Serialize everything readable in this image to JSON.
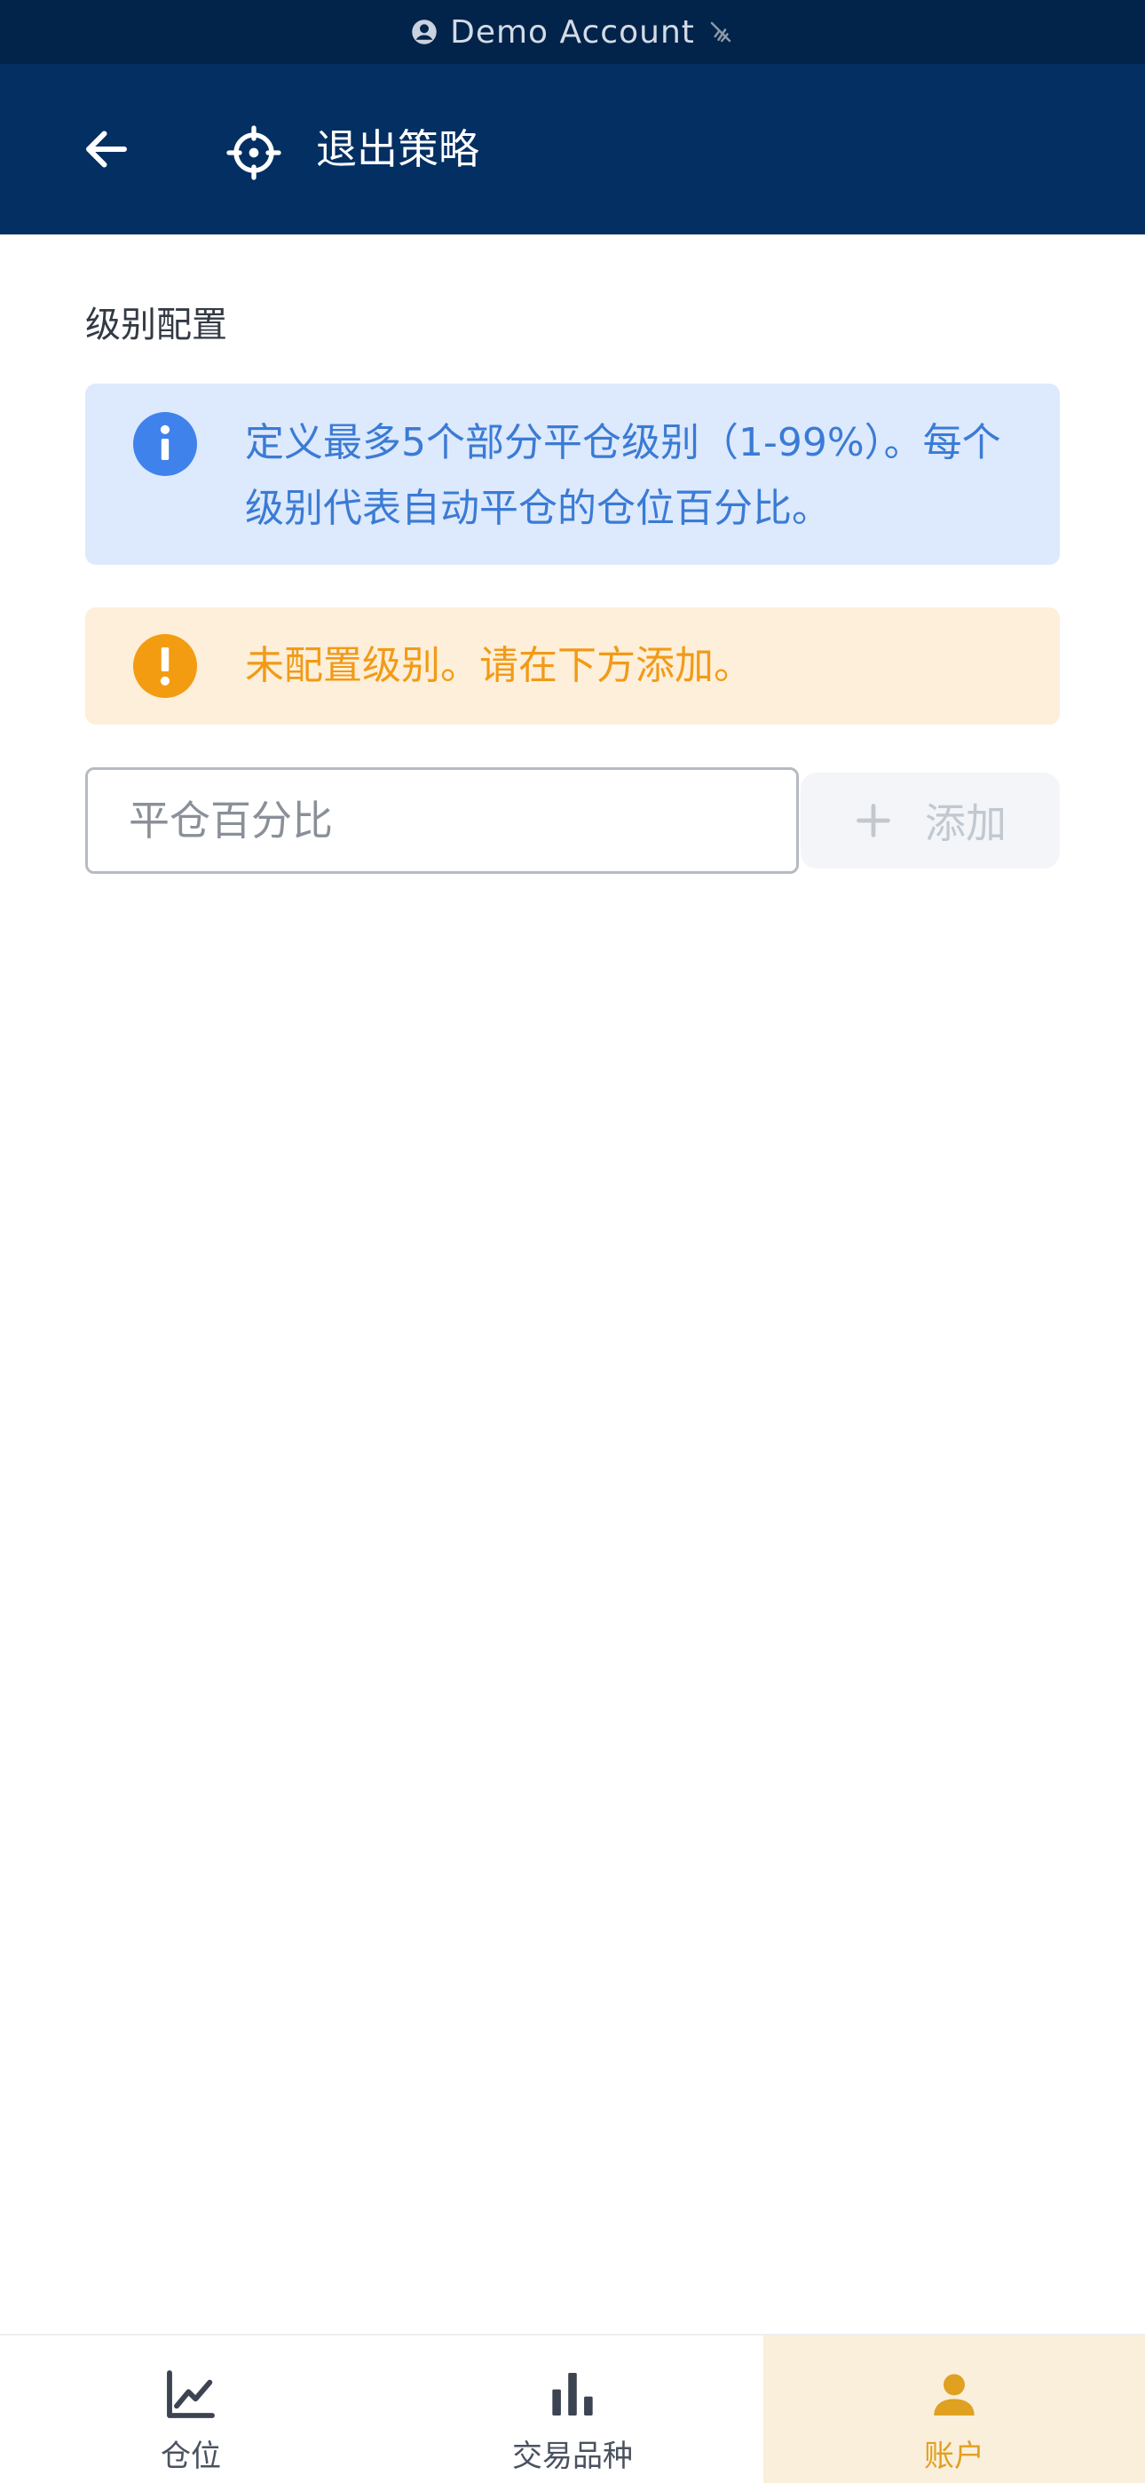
{
  "status_bar": {
    "account_label": "Demo Account",
    "account_icon": "account-circle-icon",
    "signal_icon": "no-connection-icon"
  },
  "header": {
    "back_icon": "arrow-left-icon",
    "title_icon": "crosshair-icon",
    "title": "退出策略"
  },
  "levels": {
    "section_title": "级别配置",
    "info_message": "定义最多5个部分平仓级别（1-99%）。每个级别代表自动平仓的仓位百分比。",
    "warning_message": "未配置级别。请在下方添加。",
    "input_placeholder": "平仓百分比",
    "input_value": "",
    "add_label": "添加"
  },
  "bottom_nav": {
    "items": [
      {
        "label": "仓位",
        "icon": "line-chart-icon",
        "active": false
      },
      {
        "label": "交易品种",
        "icon": "bar-chart-icon",
        "active": false
      },
      {
        "label": "账户",
        "icon": "person-icon",
        "active": true
      }
    ]
  },
  "colors": {
    "header_bg": "#032f63",
    "status_bg": "#02234a",
    "info_bg": "#dde9fc",
    "info_text": "#3a7bd5",
    "warn_bg": "#fdefd9",
    "warn_text": "#f29a17",
    "accent": "#e0a020"
  }
}
